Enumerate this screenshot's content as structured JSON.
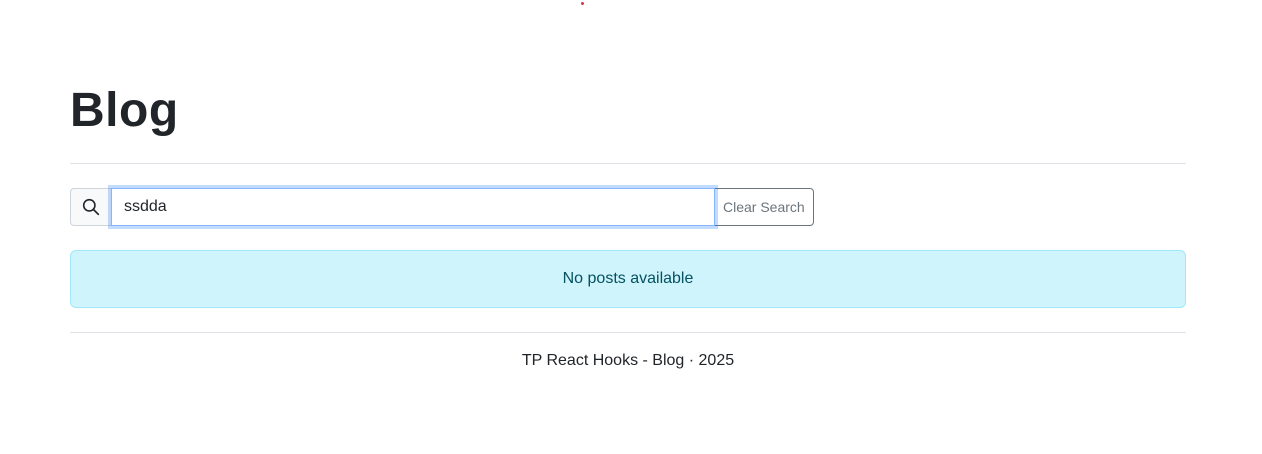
{
  "header": {
    "title": "Blog"
  },
  "search": {
    "icon": "search-icon",
    "value": "ssdda",
    "placeholder": "",
    "clear_label": "Clear Search"
  },
  "alert": {
    "message": "No posts available",
    "color": "#cff4fc"
  },
  "footer": {
    "text": "TP React Hooks - Blog · 2025"
  }
}
